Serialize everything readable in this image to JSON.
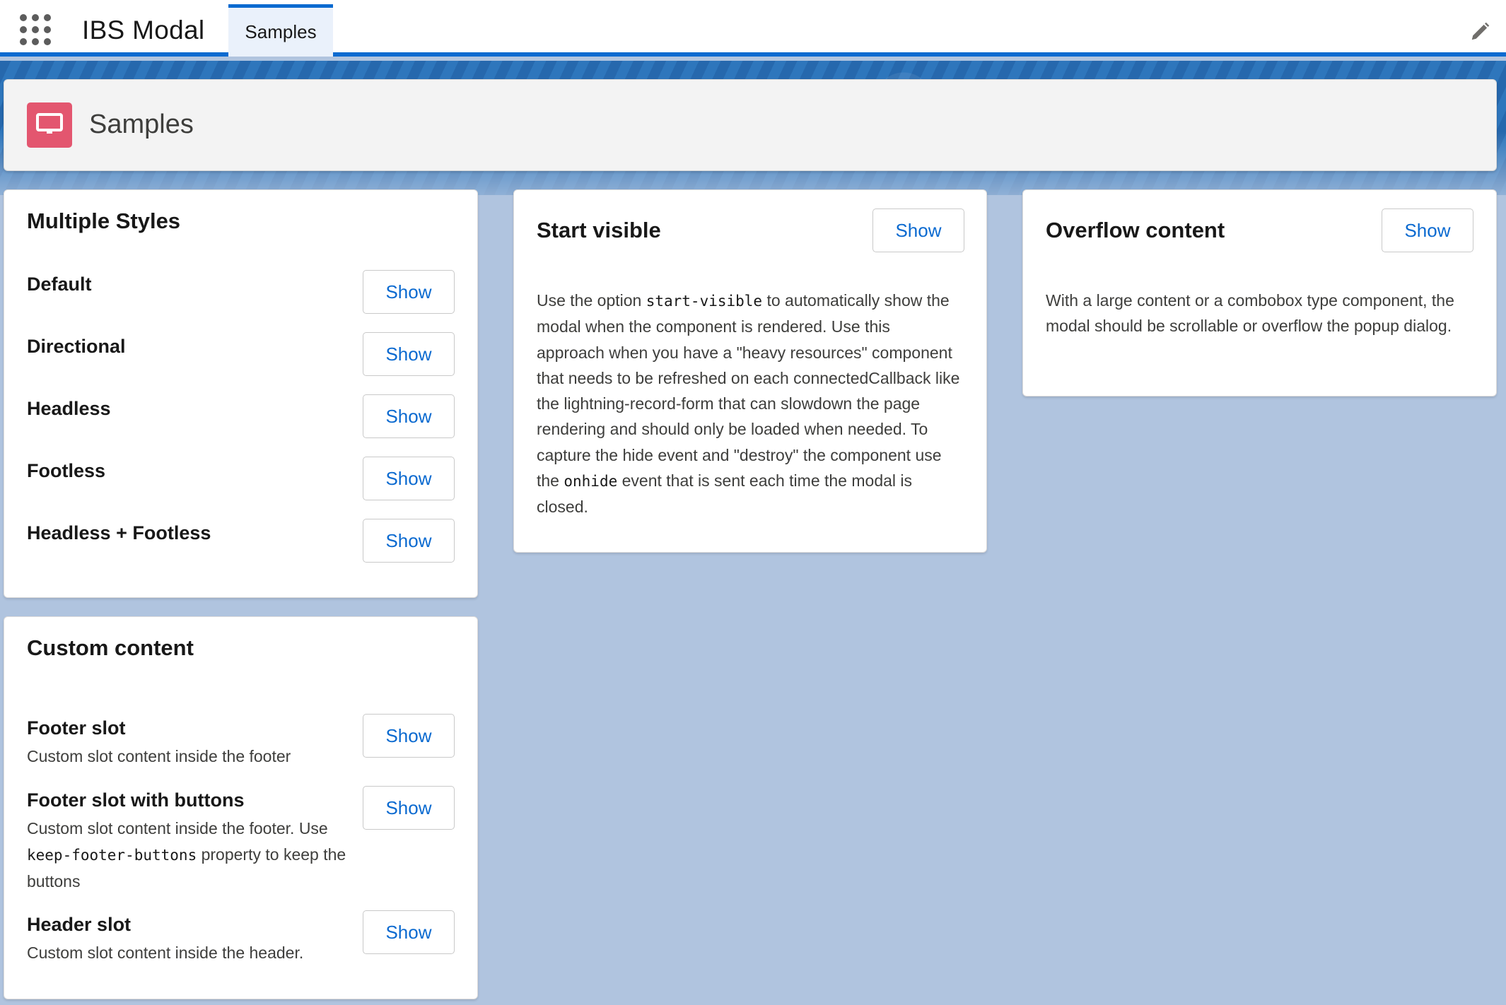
{
  "app": {
    "name": "IBS Modal",
    "nav_tabs": [
      {
        "label": "Samples",
        "active": true
      }
    ],
    "accent_color": "#0b6ad0"
  },
  "page_header": {
    "title": "Samples",
    "icon": "desktop-icon",
    "icon_color": "#e3566f"
  },
  "multiple_styles": {
    "title": "Multiple Styles",
    "rows": [
      {
        "label": "Default",
        "button": "Show"
      },
      {
        "label": "Directional",
        "button": "Show"
      },
      {
        "label": "Headless",
        "button": "Show"
      },
      {
        "label": "Footless",
        "button": "Show"
      },
      {
        "label": "Headless + Footless",
        "button": "Show"
      }
    ]
  },
  "start_visible": {
    "title": "Start visible",
    "button": "Show",
    "text_1": "Use the option ",
    "code_1": "start-visible",
    "text_2": " to automatically show the modal when the component is rendered. Use this approach when you have a \"heavy resources\" component that needs to be refreshed on each connectedCallback like the lightning-record-form that can slowdown the page rendering and should only be loaded when needed. To capture the hide event and \"destroy\" the component use the ",
    "code_2": "onhide",
    "text_3": " event that is sent each time the modal is closed."
  },
  "overflow_content": {
    "title": "Overflow content",
    "button": "Show",
    "text": "With a large content or a combobox type component, the modal should be scrollable or overflow the popup dialog."
  },
  "custom_content": {
    "title": "Custom content",
    "rows": [
      {
        "label": "Footer slot",
        "desc_text_1": "Custom slot content inside the footer",
        "button": "Show"
      },
      {
        "label": "Footer slot with buttons",
        "desc_text_1": "Custom slot content inside the footer. Use ",
        "desc_code": "keep-footer-buttons",
        "desc_text_2": " property to keep the buttons",
        "button": "Show"
      },
      {
        "label": "Header slot",
        "desc_text_1": "Custom slot content inside the header.",
        "button": "Show"
      }
    ]
  }
}
